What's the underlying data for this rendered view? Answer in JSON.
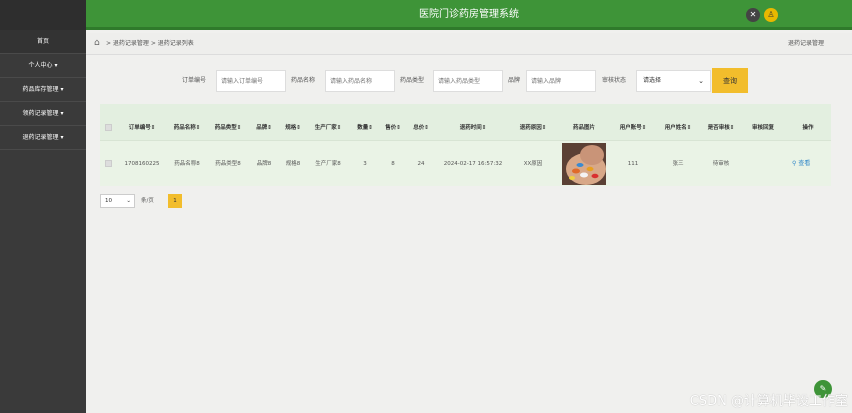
{
  "header": {
    "title": "医院门诊药房管理系统"
  },
  "sidebar": {
    "items": [
      {
        "label": "首页"
      },
      {
        "label": "个人中心 ▾"
      },
      {
        "label": "药品库存管理 ▾"
      },
      {
        "label": "领药记录管理 ▾"
      },
      {
        "label": "退药记录管理 ▾"
      }
    ]
  },
  "breadcrumb": {
    "text": "> 退药记录管理 > 退药记录列表",
    "right": "退药记录管理"
  },
  "search": {
    "order_label": "订单编号",
    "order_placeholder": "请输入订单编号",
    "name_label": "药品名称",
    "name_placeholder": "请输入药品名称",
    "type_label": "药品类型",
    "type_placeholder": "请输入药品类型",
    "brand_label": "品牌",
    "brand_placeholder": "请输入品牌",
    "status_label": "审核状态",
    "status_value": "请选择",
    "query_label": "查询"
  },
  "table": {
    "columns": [
      "订单编号⇕",
      "药品名称⇕",
      "药品类型⇕",
      "品牌⇕",
      "规格⇕",
      "生产厂家⇕",
      "数量⇕",
      "售价⇕",
      "总价⇕",
      "退药时间⇕",
      "退药原因⇕",
      "药品图片",
      "用户账号⇕",
      "用户姓名⇕",
      "是否审核⇕",
      "审核回复",
      "操作"
    ],
    "rows": [
      {
        "cells": [
          "1708160225",
          "药品名称8",
          "药品类型8",
          "品牌8",
          "规格8",
          "生产厂家8",
          "3",
          "8",
          "24",
          "2024-02-17 16:57:32",
          "XX原因",
          "",
          "111",
          "张三",
          "待审核",
          ""
        ],
        "action": "查看"
      }
    ]
  },
  "pager": {
    "size": "10",
    "unit": "条/页",
    "current": "1"
  },
  "watermark": "CSDN @计算机毕设工作室"
}
